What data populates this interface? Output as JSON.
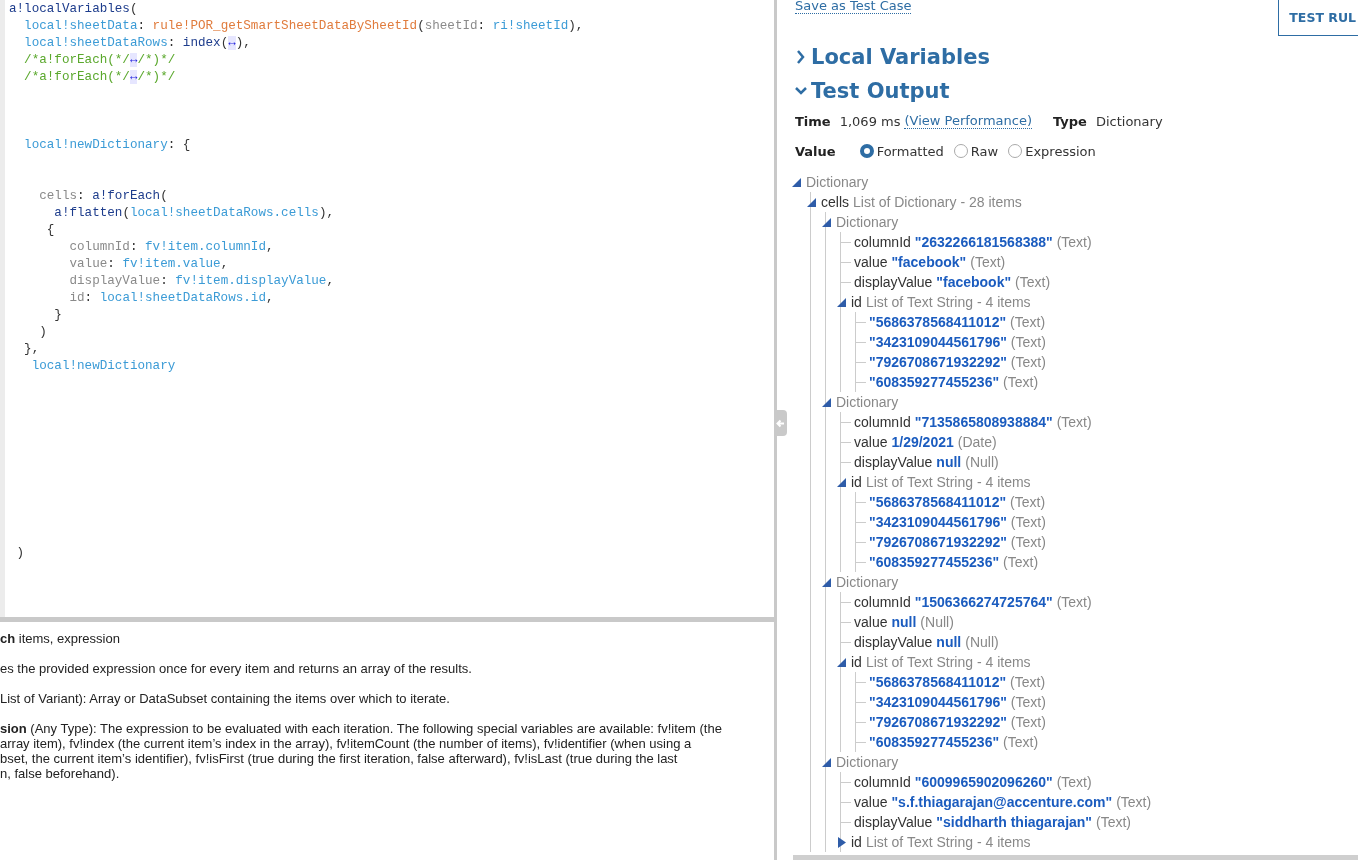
{
  "code_editor": {
    "lines": [
      {
        "kind": "code",
        "tokens": [
          {
            "text": "a!localVariables",
            "kind": "func"
          },
          {
            "text": "(",
            "kind": "plain"
          }
        ]
      },
      {
        "kind": "code",
        "tokens": [
          {
            "text": "  local!sheetData",
            "kind": "var"
          },
          {
            "text": ": ",
            "kind": "plain"
          },
          {
            "text": "rule!POR_getSmartSheetDataBySheetId",
            "kind": "rule"
          },
          {
            "text": "(",
            "kind": "plain"
          },
          {
            "text": "sheetId",
            "kind": "param"
          },
          {
            "text": ": ",
            "kind": "plain"
          },
          {
            "text": "ri!sheetId",
            "kind": "var"
          },
          {
            "text": "),",
            "kind": "plain"
          }
        ]
      },
      {
        "kind": "code",
        "tokens": [
          {
            "text": "  local!sheetDataRows",
            "kind": "var"
          },
          {
            "text": ": ",
            "kind": "plain"
          },
          {
            "text": "index",
            "kind": "func"
          },
          {
            "text": "(",
            "kind": "plain"
          },
          {
            "text": "↔",
            "kind": "fold"
          },
          {
            "text": "),",
            "kind": "plain"
          }
        ]
      },
      {
        "kind": "code",
        "tokens": [
          {
            "text": "  /*a!forEach(*/",
            "kind": "comment"
          },
          {
            "text": "↔",
            "kind": "fold"
          },
          {
            "text": "/*)*/",
            "kind": "comment"
          }
        ]
      },
      {
        "kind": "code",
        "tokens": [
          {
            "text": "  /*a!forEach(*/",
            "kind": "comment"
          },
          {
            "text": "↔",
            "kind": "fold"
          },
          {
            "text": "/*)*/",
            "kind": "comment"
          }
        ]
      },
      {
        "kind": "blank"
      },
      {
        "kind": "blank"
      },
      {
        "kind": "blank"
      },
      {
        "kind": "code",
        "tokens": [
          {
            "text": "  local!newDictionary",
            "kind": "var"
          },
          {
            "text": ": {",
            "kind": "plain"
          }
        ]
      },
      {
        "kind": "blank"
      },
      {
        "kind": "blank"
      },
      {
        "kind": "code",
        "tokens": [
          {
            "text": "    cells",
            "kind": "param"
          },
          {
            "text": ": ",
            "kind": "plain"
          },
          {
            "text": "a!forEach",
            "kind": "func"
          },
          {
            "text": "(",
            "kind": "plain"
          }
        ]
      },
      {
        "kind": "code",
        "tokens": [
          {
            "text": "      a!flatten",
            "kind": "func"
          },
          {
            "text": "(",
            "kind": "plain"
          },
          {
            "text": "local!sheetDataRows.cells",
            "kind": "var"
          },
          {
            "text": "),",
            "kind": "plain"
          }
        ]
      },
      {
        "kind": "code",
        "tokens": [
          {
            "text": "     {",
            "kind": "plain"
          }
        ]
      },
      {
        "kind": "code",
        "tokens": [
          {
            "text": "        columnId",
            "kind": "param"
          },
          {
            "text": ": ",
            "kind": "plain"
          },
          {
            "text": "fv!item.columnId",
            "kind": "var"
          },
          {
            "text": ",",
            "kind": "plain"
          }
        ]
      },
      {
        "kind": "code",
        "tokens": [
          {
            "text": "        value",
            "kind": "param"
          },
          {
            "text": ": ",
            "kind": "plain"
          },
          {
            "text": "fv!item.value",
            "kind": "var"
          },
          {
            "text": ",",
            "kind": "plain"
          }
        ]
      },
      {
        "kind": "code",
        "tokens": [
          {
            "text": "        displayValue",
            "kind": "param"
          },
          {
            "text": ": ",
            "kind": "plain"
          },
          {
            "text": "fv!item.displayValue",
            "kind": "var"
          },
          {
            "text": ",",
            "kind": "plain"
          }
        ]
      },
      {
        "kind": "code",
        "tokens": [
          {
            "text": "        id",
            "kind": "param"
          },
          {
            "text": ": ",
            "kind": "plain"
          },
          {
            "text": "local!sheetDataRows.id",
            "kind": "var"
          },
          {
            "text": ",",
            "kind": "plain"
          }
        ]
      },
      {
        "kind": "code",
        "tokens": [
          {
            "text": "      }",
            "kind": "plain"
          }
        ]
      },
      {
        "kind": "code",
        "tokens": [
          {
            "text": "    )",
            "kind": "plain"
          }
        ]
      },
      {
        "kind": "code",
        "tokens": [
          {
            "text": "  },",
            "kind": "plain"
          }
        ]
      },
      {
        "kind": "code",
        "tokens": [
          {
            "text": "   local!newDictionary",
            "kind": "var"
          }
        ]
      },
      {
        "kind": "blank"
      },
      {
        "kind": "blank"
      },
      {
        "kind": "blank"
      },
      {
        "kind": "blank"
      },
      {
        "kind": "blank"
      },
      {
        "kind": "blank"
      },
      {
        "kind": "blank"
      },
      {
        "kind": "blank"
      },
      {
        "kind": "blank"
      },
      {
        "kind": "blank"
      },
      {
        "kind": "code",
        "tokens": [
          {
            "text": " )",
            "kind": "plain"
          }
        ]
      }
    ]
  },
  "function_help": {
    "paragraphs": [
      [
        "**ch**  items, expression"
      ],
      [
        "es the provided expression once for every item and returns an array of the results."
      ],
      [
        "List of Variant): Array or DataSubset containing the items over which to iterate."
      ],
      [
        "**sion** (Any Type): The expression to be evaluated with each iteration. The following special variables are available: fv!item (the",
        " array item), fv!index (the current item’s index in the array), fv!itemCount (the number of items), fv!identifier (when using a",
        "bset, the current item’s identifier), fv!isFirst (true during the first iteration, false afterward), fv!isLast (true during the last",
        "n, false beforehand)."
      ]
    ]
  },
  "test_panel": {
    "save_link": "Save as Test Case",
    "test_button": "TEST RUL",
    "sections": [
      {
        "title": "Local Variables",
        "expanded": false
      },
      {
        "title": "Test Output",
        "expanded": true
      }
    ],
    "time_label": "Time",
    "time": "1,069 ms",
    "performance_link": "(View Performance)",
    "type_label": "Type",
    "type": "Dictionary",
    "value_label": "Value",
    "value_options": [
      {
        "label": "Formatted",
        "selected": true
      },
      {
        "label": "Raw",
        "selected": false
      },
      {
        "label": "Expression",
        "selected": false
      }
    ],
    "tree": [
      {
        "summary": "Dictionary",
        "expanded": true,
        "children": [
          {
            "name": "cells",
            "summary": "List of Dictionary - 28 items",
            "expanded": true,
            "children": [
              {
                "summary": "Dictionary",
                "expanded": true,
                "children": [
                  {
                    "name": "columnId",
                    "value": "\"2632266181568388\"",
                    "type": "(Text)"
                  },
                  {
                    "name": "value",
                    "value": "\"facebook\"",
                    "type": "(Text)"
                  },
                  {
                    "name": "displayValue",
                    "value": "\"facebook\"",
                    "type": "(Text)"
                  },
                  {
                    "name": "id",
                    "summary": "List of Text String - 4 items",
                    "expanded": true,
                    "children": [
                      {
                        "value": "\"5686378568411012\"",
                        "type": "(Text)"
                      },
                      {
                        "value": "\"3423109044561796\"",
                        "type": "(Text)"
                      },
                      {
                        "value": "\"7926708671932292\"",
                        "type": "(Text)"
                      },
                      {
                        "value": "\"608359277455236\"",
                        "type": "(Text)"
                      }
                    ]
                  }
                ]
              },
              {
                "summary": "Dictionary",
                "expanded": true,
                "children": [
                  {
                    "name": "columnId",
                    "value": "\"7135865808938884\"",
                    "type": "(Text)"
                  },
                  {
                    "name": "value",
                    "value": "1/29/2021",
                    "type": "(Date)"
                  },
                  {
                    "name": "displayValue",
                    "value": "null",
                    "type": "(Null)"
                  },
                  {
                    "name": "id",
                    "summary": "List of Text String - 4 items",
                    "expanded": true,
                    "children": [
                      {
                        "value": "\"5686378568411012\"",
                        "type": "(Text)"
                      },
                      {
                        "value": "\"3423109044561796\"",
                        "type": "(Text)"
                      },
                      {
                        "value": "\"7926708671932292\"",
                        "type": "(Text)"
                      },
                      {
                        "value": "\"608359277455236\"",
                        "type": "(Text)"
                      }
                    ]
                  }
                ]
              },
              {
                "summary": "Dictionary",
                "expanded": true,
                "children": [
                  {
                    "name": "columnId",
                    "value": "\"1506366274725764\"",
                    "type": "(Text)"
                  },
                  {
                    "name": "value",
                    "value": "null",
                    "type": "(Null)"
                  },
                  {
                    "name": "displayValue",
                    "value": "null",
                    "type": "(Null)"
                  },
                  {
                    "name": "id",
                    "summary": "List of Text String - 4 items",
                    "expanded": true,
                    "children": [
                      {
                        "value": "\"5686378568411012\"",
                        "type": "(Text)"
                      },
                      {
                        "value": "\"3423109044561796\"",
                        "type": "(Text)"
                      },
                      {
                        "value": "\"7926708671932292\"",
                        "type": "(Text)"
                      },
                      {
                        "value": "\"608359277455236\"",
                        "type": "(Text)"
                      }
                    ]
                  }
                ]
              },
              {
                "summary": "Dictionary",
                "expanded": true,
                "children": [
                  {
                    "name": "columnId",
                    "value": "\"6009965902096260\"",
                    "type": "(Text)"
                  },
                  {
                    "name": "value",
                    "value": "\"s.f.thiagarajan@accenture.com\"",
                    "type": "(Text)"
                  },
                  {
                    "name": "displayValue",
                    "value": "\"siddharth thiagarajan\"",
                    "type": "(Text)"
                  },
                  {
                    "name": "id",
                    "summary": "List of Text String - 4 items",
                    "expanded": false
                  }
                ]
              }
            ]
          }
        ]
      }
    ]
  }
}
